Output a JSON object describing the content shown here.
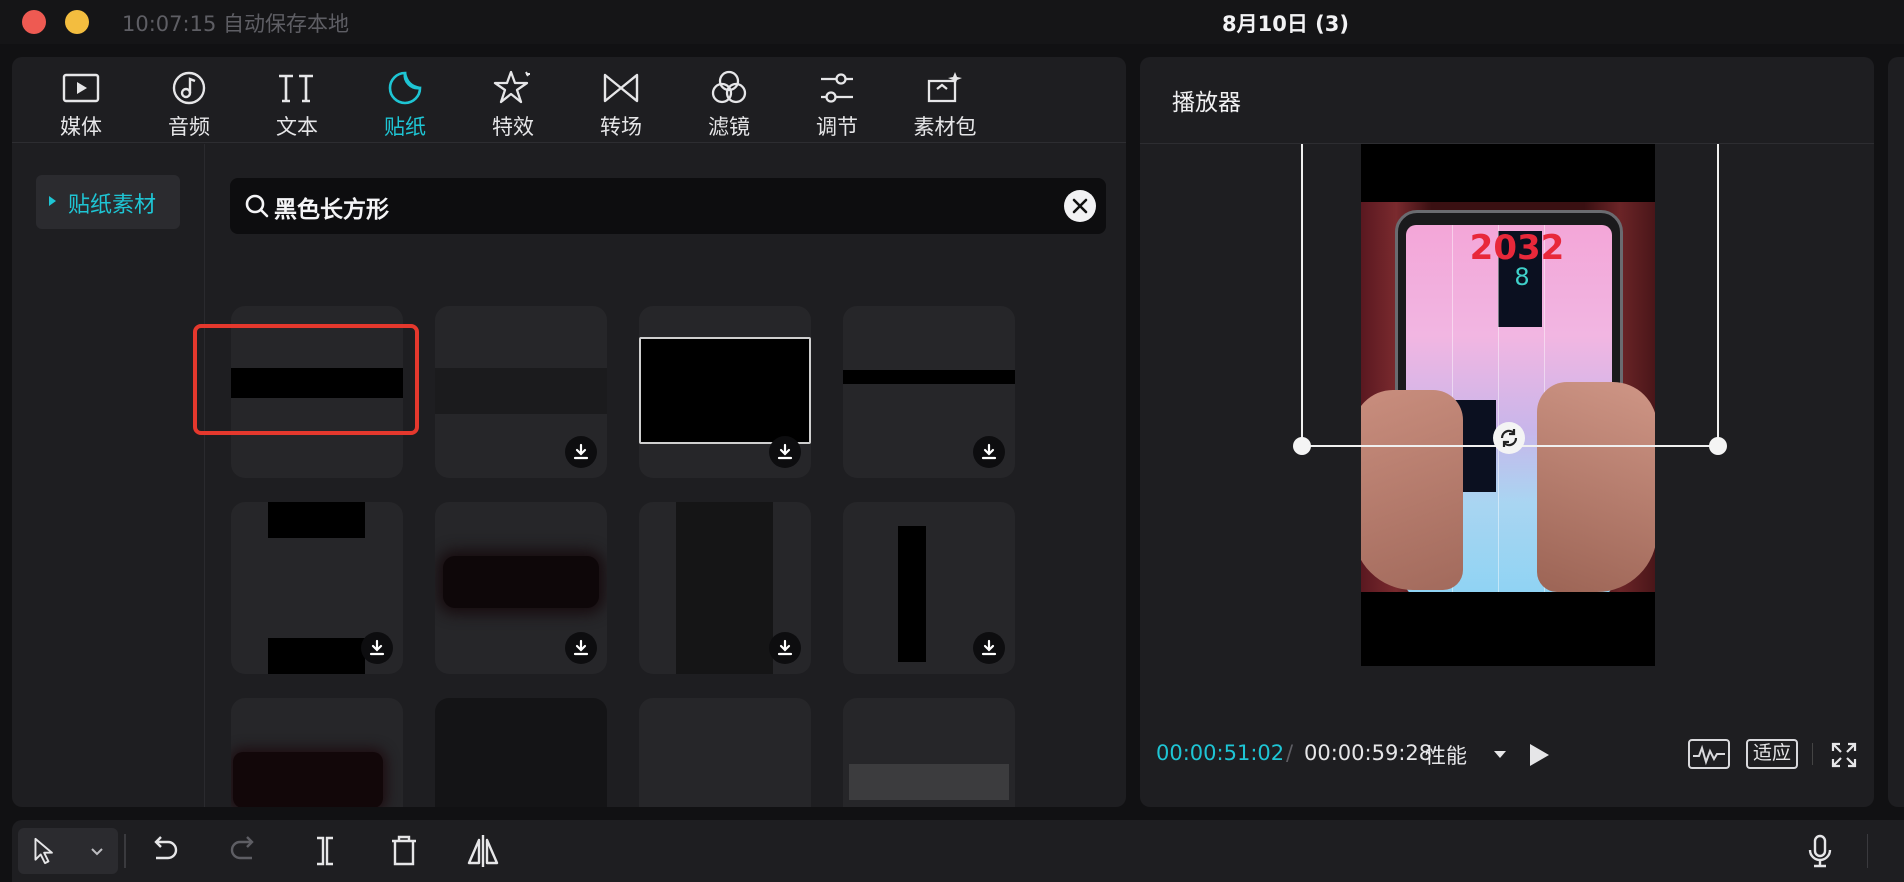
{
  "window": {
    "autosave_status": "10:07:15 自动保存本地",
    "project_title": "8月10日 (3)"
  },
  "toolbar": {
    "tabs": [
      {
        "label": "媒体",
        "icon": "media-icon",
        "active": false
      },
      {
        "label": "音频",
        "icon": "audio-icon",
        "active": false
      },
      {
        "label": "文本",
        "icon": "text-icon",
        "active": false
      },
      {
        "label": "贴纸",
        "icon": "sticker-icon",
        "active": true
      },
      {
        "label": "特效",
        "icon": "effects-icon",
        "active": false
      },
      {
        "label": "转场",
        "icon": "transition-icon",
        "active": false
      },
      {
        "label": "滤镜",
        "icon": "filter-icon",
        "active": false
      },
      {
        "label": "调节",
        "icon": "adjust-icon",
        "active": false
      },
      {
        "label": "素材包",
        "icon": "asset-pack-icon",
        "active": false
      }
    ],
    "accent_color": "#1ec5d4"
  },
  "sidebar": {
    "category_label": "贴纸素材"
  },
  "search": {
    "query": "黑色长方形"
  },
  "stickers": {
    "selected_index": 0,
    "selection_color": "#e5382d",
    "items": [
      {
        "name": "black-bar-sticker",
        "downloaded": true
      },
      {
        "name": "letterbox-sticker",
        "downloaded": false
      },
      {
        "name": "black-rectangle-outlined-sticker",
        "downloaded": false
      },
      {
        "name": "thin-black-line-sticker",
        "downloaded": false
      },
      {
        "name": "top-bottom-bars-sticker",
        "downloaded": false
      },
      {
        "name": "blurred-black-bar-sticker",
        "downloaded": false
      },
      {
        "name": "vertical-dark-panel-sticker",
        "downloaded": false
      },
      {
        "name": "vertical-black-bar-sticker",
        "downloaded": false
      },
      {
        "name": "blurred-dark-bar-sticker",
        "downloaded": false
      },
      {
        "name": "dark-texture-sticker",
        "downloaded": false
      },
      {
        "name": "blank-sticker",
        "downloaded": false
      },
      {
        "name": "gray-bar-sticker",
        "downloaded": false
      }
    ]
  },
  "player": {
    "title": "播放器",
    "video_score": "2032",
    "video_combo": "8",
    "current_time": "00:00:51:02",
    "total_time": "00:00:59:28",
    "separator": "/",
    "quality_label": "性能",
    "fit_label": "适应"
  }
}
